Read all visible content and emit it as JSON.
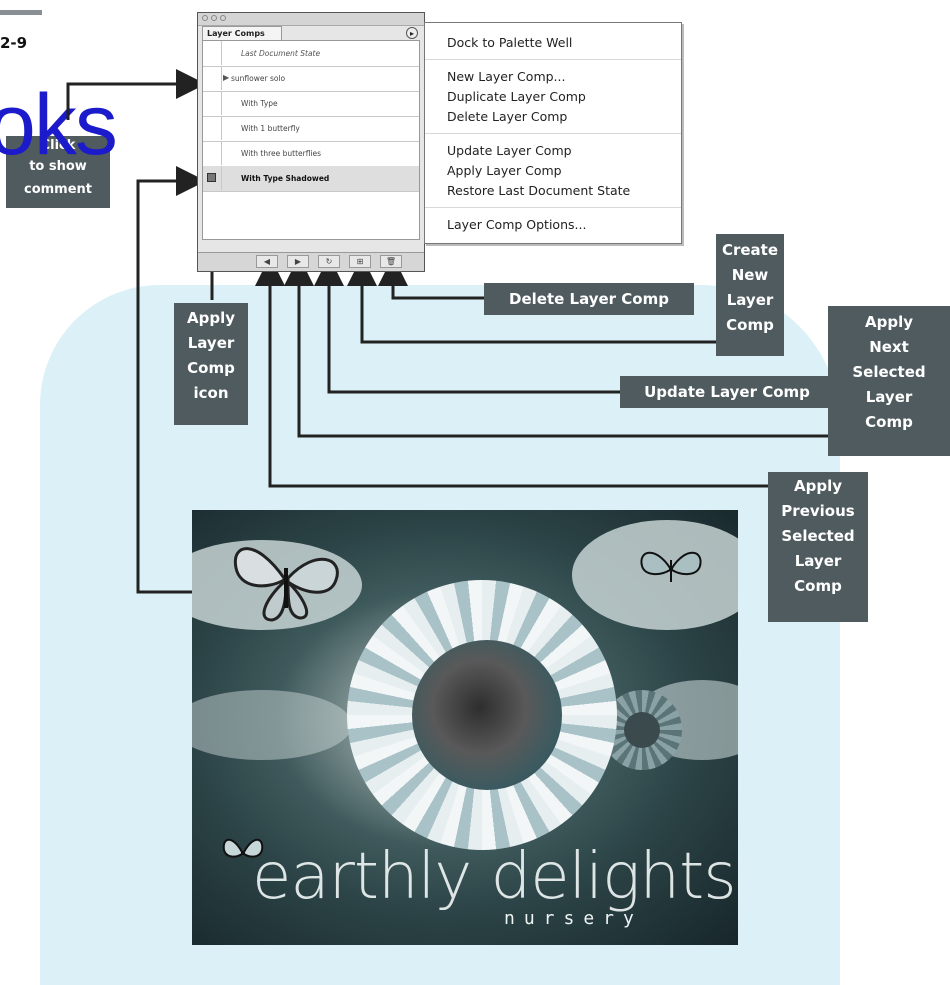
{
  "figure": {
    "number": "2-9",
    "watermark": "oks",
    "click_note": [
      "Click",
      "to show",
      "comment"
    ]
  },
  "palette": {
    "tab_label": "Layer Comps",
    "menu_button": "▸",
    "rows": [
      {
        "label": "Last Document State"
      },
      {
        "label": "sunflower solo",
        "arrow": "▶"
      },
      {
        "label": "With Type"
      },
      {
        "label": "With 1 butterfly"
      },
      {
        "label": "With three butterflies"
      },
      {
        "label": "With Type Shadowed"
      }
    ],
    "bottom_buttons": [
      "◀",
      "▶",
      "↻",
      "⊞",
      "🗑"
    ]
  },
  "flyout_menu": {
    "items": [
      "Dock to Palette Well",
      "New Layer Comp...",
      "Duplicate Layer Comp",
      "Delete Layer Comp",
      "Update Layer Comp",
      "Apply Layer Comp",
      "Restore Last Document State",
      "Layer Comp Options..."
    ]
  },
  "callouts": {
    "delete": "Delete Layer Comp",
    "create": [
      "Create",
      "New",
      "Layer",
      "Comp"
    ],
    "apply_next": [
      "Apply",
      "Next",
      "Selected",
      "Layer",
      "Comp"
    ],
    "update": "Update Layer Comp",
    "apply_icon": [
      "Apply",
      "Layer",
      "Comp",
      "icon"
    ],
    "apply_previous": [
      "Apply",
      "Previous",
      "Selected",
      "Layer",
      "Comp"
    ]
  },
  "artwork": {
    "logo_main": "earthly delights",
    "logo_sub": "nursery"
  },
  "colors": {
    "callout_bg": "#4f5b5e",
    "background_blob": "#dcf1f7",
    "watermark": "#1b1bcc"
  }
}
